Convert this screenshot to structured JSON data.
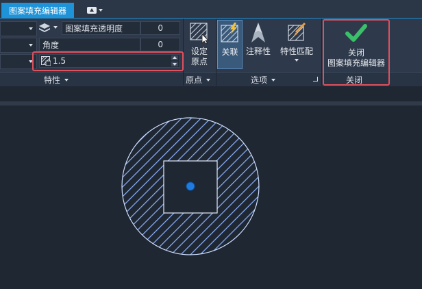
{
  "tabs": {
    "active_label": "图案填充编辑器"
  },
  "properties": {
    "transparency_label": "图案填充透明度",
    "transparency_value": "0",
    "angle_label": "角度",
    "angle_value": "0",
    "scale_value": "1.5",
    "group_label": "特性"
  },
  "origin": {
    "set_origin_line1": "设定",
    "set_origin_line2": "原点",
    "group_label": "原点"
  },
  "options": {
    "associative_label": "关联",
    "annotative_label": "注释性",
    "match_properties_label": "特性匹配",
    "group_label": "选项"
  },
  "close": {
    "button_line1": "关闭",
    "button_line2": "图案填充编辑器",
    "group_label": "关闭"
  },
  "colors": {
    "accent": "#1e93d8",
    "highlight": "#e0505d",
    "check": "#3cbf6a",
    "hatch": "#8fb4ff"
  }
}
